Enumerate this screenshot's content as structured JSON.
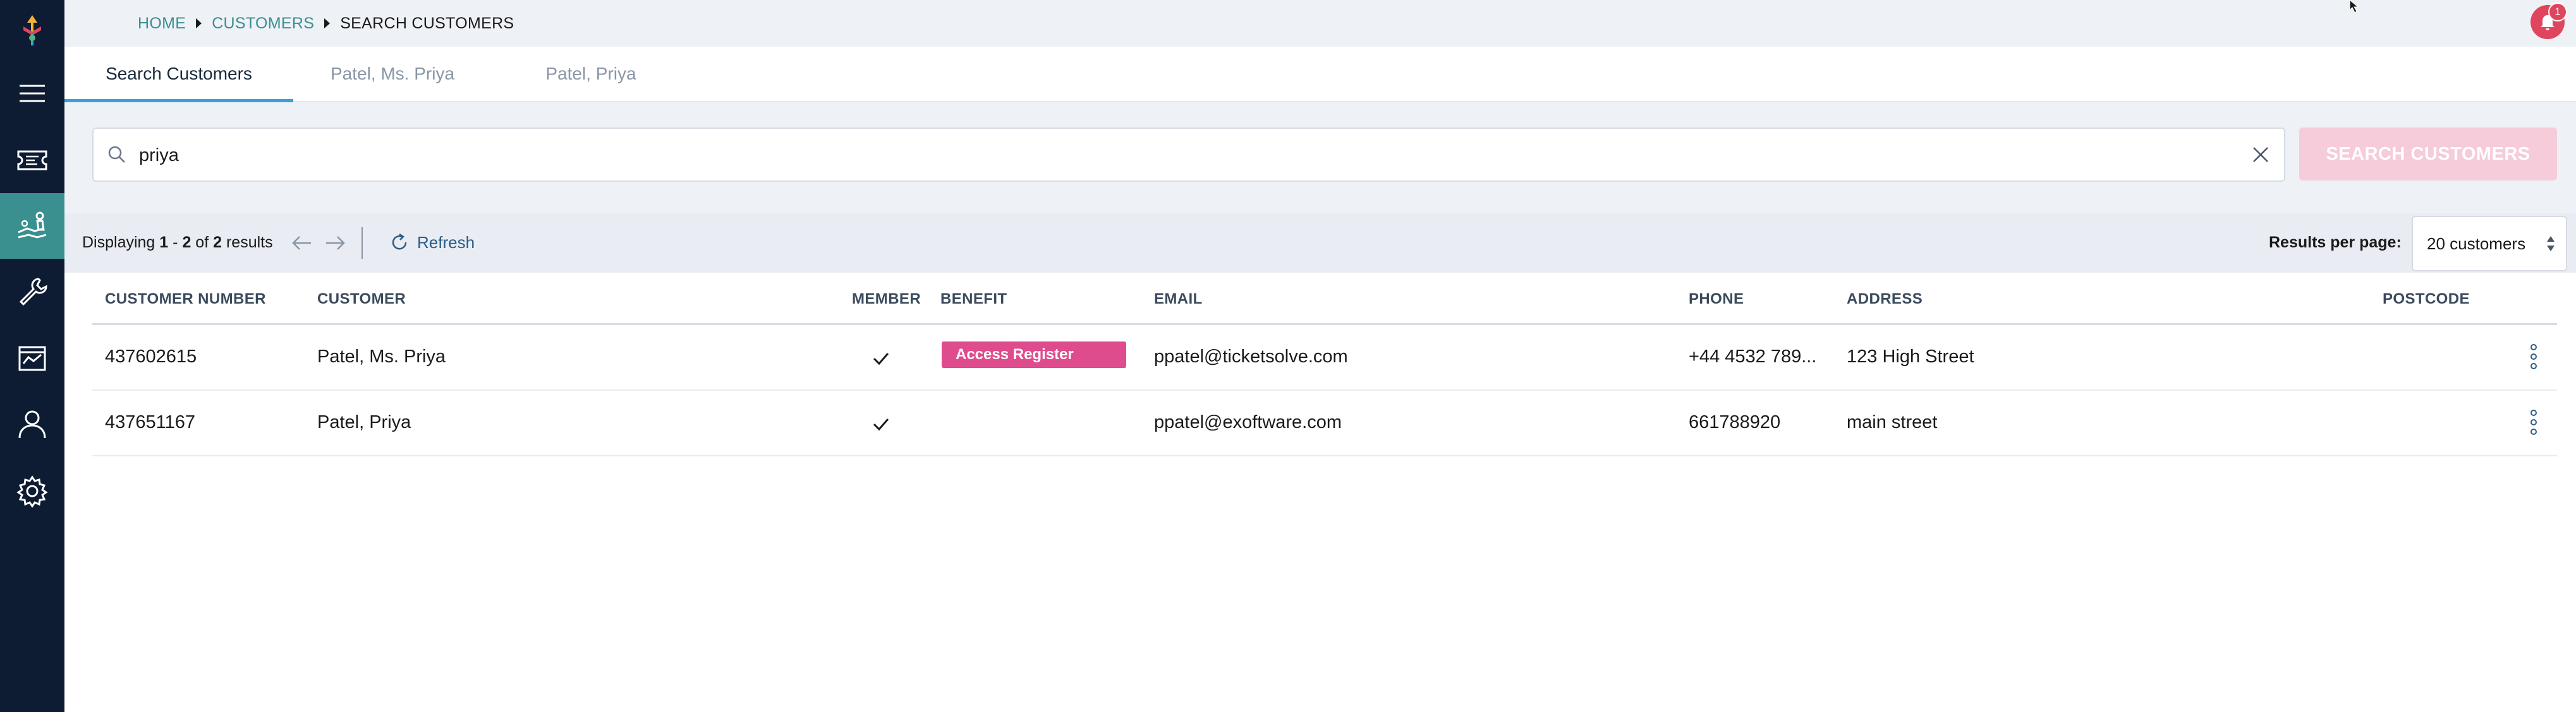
{
  "breadcrumb": {
    "home": "HOME",
    "customers": "CUSTOMERS",
    "current": "SEARCH CUSTOMERS"
  },
  "notifications": {
    "count": "1"
  },
  "tabs": [
    {
      "label": "Search Customers"
    },
    {
      "label": "Patel, Ms. Priya"
    },
    {
      "label": "Patel, Priya"
    }
  ],
  "search": {
    "value": "priya",
    "button_label": "SEARCH CUSTOMERS"
  },
  "results": {
    "prefix": "Displaying",
    "from": "1",
    "dash": "-",
    "to": "2",
    "of": "of",
    "total": "2",
    "suffix": "results",
    "refresh_label": "Refresh",
    "per_page_label": "Results per page:",
    "per_page_value": "20 customers"
  },
  "table": {
    "headers": {
      "customer_number": "CUSTOMER NUMBER",
      "customer": "CUSTOMER",
      "member": "MEMBER",
      "benefit": "BENEFIT",
      "email": "EMAIL",
      "phone": "PHONE",
      "address": "ADDRESS",
      "postcode": "POSTCODE"
    },
    "rows": [
      {
        "customer_number": "437602615",
        "customer": "Patel, Ms. Priya",
        "member": true,
        "benefit": "Access Register",
        "email": "ppatel@ticketsolve.com",
        "phone": "+44 4532 789...",
        "address": "123 High Street",
        "postcode": ""
      },
      {
        "customer_number": "437651167",
        "customer": "Patel, Priya",
        "member": true,
        "benefit": "",
        "email": "ppatel@exoftware.com",
        "phone": "661788920",
        "address": "main street",
        "postcode": ""
      }
    ]
  },
  "colors": {
    "sidebar_bg": "#0d1b33",
    "sidebar_active": "#3a8f8f",
    "accent_teal": "#3a8f8f",
    "tab_underline": "#3aa0d8",
    "badge_pink": "#df4c8e",
    "search_button_disabled": "#f6cbda",
    "notification_red": "#e0455e"
  },
  "icons": {
    "sidebar": [
      "menu-icon",
      "ticket-icon",
      "customers-icon",
      "tools-icon",
      "reports-icon",
      "user-icon",
      "settings-icon"
    ],
    "search": "search-icon",
    "clear": "close-icon",
    "refresh": "refresh-icon",
    "prev": "arrow-left-icon",
    "next": "arrow-right-icon",
    "row_actions": "kebab-menu-icon"
  }
}
